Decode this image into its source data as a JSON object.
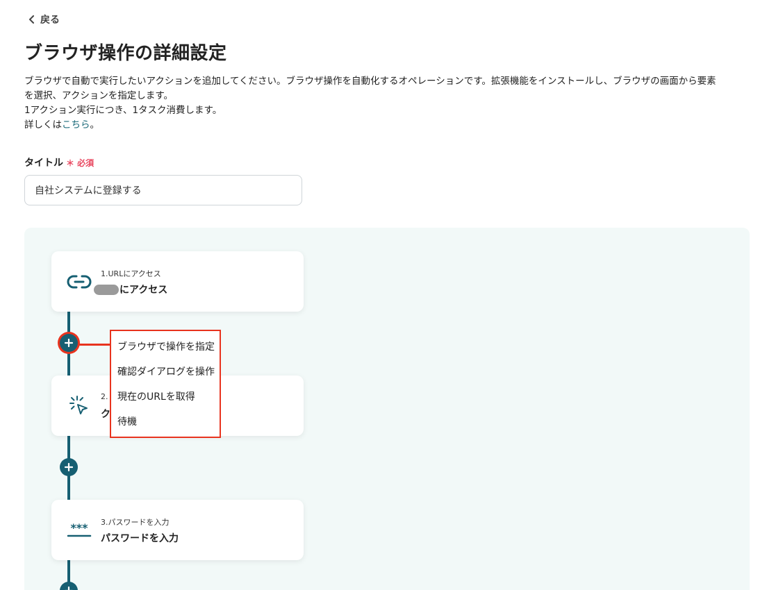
{
  "nav": {
    "back_label": "戻る"
  },
  "page": {
    "title": "ブラウザ操作の詳細設定",
    "description_lines": [
      "ブラウザで自動で実行したいアクションを追加してください。ブラウザ操作を自動化するオペレーションです。拡張機能をインストールし、ブラウザの画面から要素",
      "を選択、アクションを指定します。",
      "1アクション実行につき、1タスク消費します。"
    ],
    "details_prefix": "詳しくは",
    "details_link": "こちら",
    "details_suffix": "。"
  },
  "form": {
    "title_label": "タイトル",
    "required_mark": "＊ 必須",
    "title_value": "自社システムに登録する"
  },
  "flow": {
    "steps": [
      {
        "label": "1.URLにアクセス",
        "title": "にアクセス",
        "icon": "link-icon"
      },
      {
        "label": "2.",
        "title": "ク",
        "icon": "click-cursor-icon"
      },
      {
        "label": "3.パスワードを入力",
        "title": "パスワードを入力",
        "icon": "password-icon"
      }
    ],
    "menu_items": [
      "ブラウザで操作を指定",
      "確認ダイアログを操作",
      "現在のURLを取得",
      "待機"
    ]
  },
  "colors": {
    "accent": "#165f72",
    "highlight": "#e8331e",
    "required": "#e8475f",
    "flow_bg": "#f2f9f8"
  }
}
